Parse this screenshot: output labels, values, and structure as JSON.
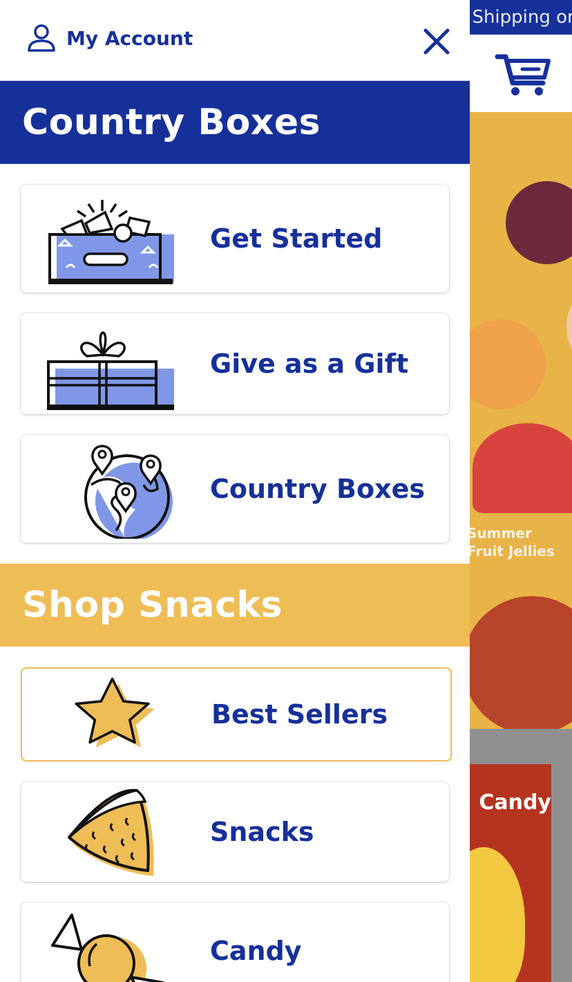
{
  "background": {
    "promo_text": "Free Shipping on Orders",
    "hero_caption": "Summer\nFruit Jellies",
    "product_card_text": "Candy"
  },
  "drawer": {
    "account_label": "My Account",
    "sections": [
      {
        "title": "Country Boxes",
        "color": "#16309a",
        "items": [
          {
            "label": "Get Started",
            "icon": "open-box-icon"
          },
          {
            "label": "Give as a Gift",
            "icon": "gift-icon"
          },
          {
            "label": "Country Boxes",
            "icon": "globe-pins-icon"
          }
        ]
      },
      {
        "title": "Shop Snacks",
        "color": "#eebd56",
        "items": [
          {
            "label": "Best Sellers",
            "icon": "star-icon",
            "active": true
          },
          {
            "label": "Snacks",
            "icon": "chip-icon"
          },
          {
            "label": "Candy",
            "icon": "candy-icon"
          }
        ]
      }
    ]
  },
  "colors": {
    "brand_blue": "#16309a",
    "accent_yellow": "#eebd56",
    "icon_blue": "#7f97e6"
  }
}
